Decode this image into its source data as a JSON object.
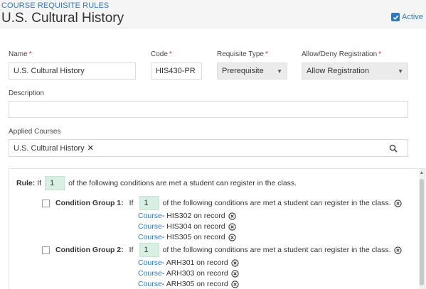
{
  "header": {
    "breadcrumb": "COURSE REQUISITE RULES",
    "title": "U.S. Cultural History",
    "active_label": "Active",
    "active_checked": true
  },
  "form": {
    "name_label": "Name",
    "name_value": "U.S. Cultural History",
    "code_label": "Code",
    "code_value": "HIS430-PR",
    "requisite_type_label": "Requisite Type",
    "requisite_type_value": "Prerequisite",
    "allow_deny_label": "Allow/Deny Registration",
    "allow_deny_value": "Allow Registration",
    "description_label": "Description",
    "description_value": "",
    "applied_courses_label": "Applied Courses",
    "applied_courses": [
      "U.S. Cultural History"
    ],
    "required_marker": "*"
  },
  "rule": {
    "prefix": "Rule:",
    "if_text": "If",
    "count": "1",
    "suffix": "of the following conditions are met a student can register in the class.",
    "groups": [
      {
        "label": "Condition Group 1:",
        "if_text": "If",
        "count": "1",
        "suffix": "of the following conditions are met a student can register in the class.",
        "conditions": [
          {
            "link": "Course",
            "text": " - HIS302 on record"
          },
          {
            "link": "Course",
            "text": " - HIS304 on record"
          },
          {
            "link": "Course",
            "text": " - HIS305 on record"
          }
        ]
      },
      {
        "label": "Condition Group 2:",
        "if_text": "If",
        "count": "1",
        "suffix": "of the following conditions are met a student can register in the class.",
        "conditions": [
          {
            "link": "Course",
            "text": " - ARH301 on record"
          },
          {
            "link": "Course",
            "text": " - ARH303 on record"
          },
          {
            "link": "Course",
            "text": " - ARH305 on record"
          }
        ]
      }
    ]
  },
  "colors": {
    "accent": "#2f7abf",
    "required": "#d0342c",
    "count_box": "#d8efe3"
  },
  "icons": {
    "active_checkbox": "check-icon",
    "tag_remove": "close-icon",
    "search": "search-icon",
    "select_caret": "caret-down-icon",
    "remove_condition": "circle-x-icon"
  }
}
